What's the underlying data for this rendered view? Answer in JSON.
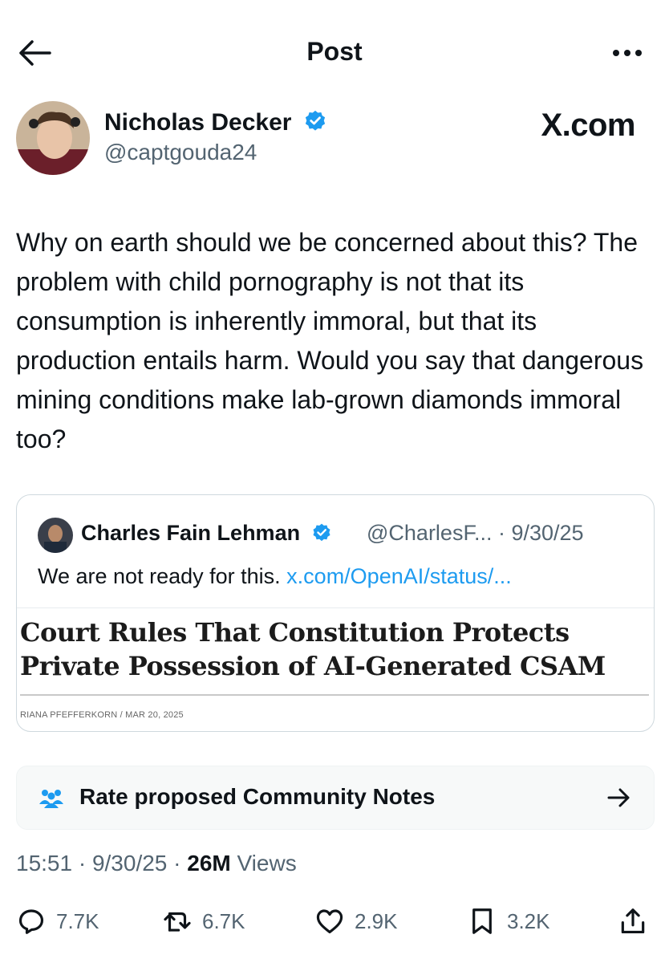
{
  "header": {
    "title": "Post",
    "back_icon": "arrow-left-icon",
    "more_icon": "more-horizontal-icon"
  },
  "author": {
    "name": "Nicholas Decker",
    "handle": "@captgouda24",
    "verified": true
  },
  "brand": {
    "watermark": "X.com"
  },
  "post": {
    "text": "Why on earth should we be concerned about this? The problem with child pornography is not that its consumption is inherently immoral, but that its production entails harm. Would you say that dangerous mining conditions make lab-grown diamonds immoral too?"
  },
  "quote": {
    "name": "Charles Fain Lehman",
    "handle_date": "@CharlesF... · 9/30/25",
    "text": "We are not ready for this.",
    "link": "x.com/OpenAI/status/...",
    "headline": "Court Rules That Constitution Protects Private Possession of AI-Generated CSAM",
    "byline": "RIANA PFEFFERKORN / MAR 20, 2025"
  },
  "notes": {
    "label": "Rate proposed Community Notes"
  },
  "meta": {
    "time_date": "15:51 · 9/30/25 · ",
    "views_count": "26M",
    "views_label": " Views"
  },
  "actions": {
    "replies": "7.7K",
    "reposts": "6.7K",
    "likes": "2.9K",
    "bookmarks": "3.2K"
  },
  "colors": {
    "accent": "#1d9bf0",
    "text": "#0f1419",
    "muted": "#536471"
  }
}
